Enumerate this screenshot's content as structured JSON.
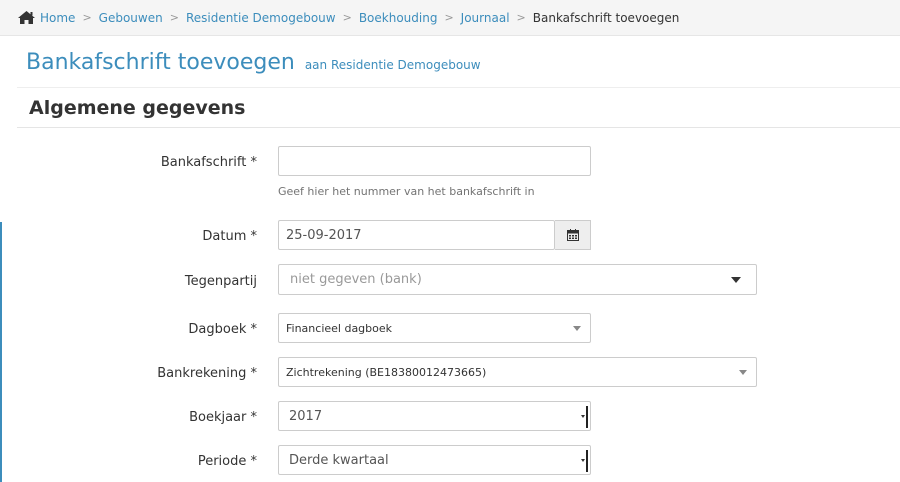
{
  "breadcrumb": {
    "items": [
      "Home",
      "Gebouwen",
      "Residentie Demogebouw",
      "Boekhouding",
      "Journaal"
    ],
    "current": "Bankafschrift toevoegen"
  },
  "header": {
    "title": "Bankafschrift toevoegen",
    "subtitle": "aan Residentie Demogebouw"
  },
  "section": {
    "title": "Algemene gegevens"
  },
  "form": {
    "bankafschrift": {
      "label": "Bankafschrift *",
      "value": "",
      "help": "Geef hier het nummer van het bankafschrift in"
    },
    "datum": {
      "label": "Datum *",
      "value": "25-09-2017",
      "icon": "calendar-icon"
    },
    "tegenpartij": {
      "label": "Tegenpartij",
      "placeholder": "niet gegeven (bank)"
    },
    "dagboek": {
      "label": "Dagboek *",
      "value": "Financieel dagboek"
    },
    "bankrekening": {
      "label": "Bankrekening *",
      "value": "Zichtrekening (BE18380012473665)"
    },
    "boekjaar": {
      "label": "Boekjaar *",
      "value": "2017"
    },
    "periode": {
      "label": "Periode *",
      "value": "Derde kwartaal"
    }
  },
  "colors": {
    "accent": "#3c8dbc",
    "text": "#333333",
    "border": "#cccccc"
  }
}
